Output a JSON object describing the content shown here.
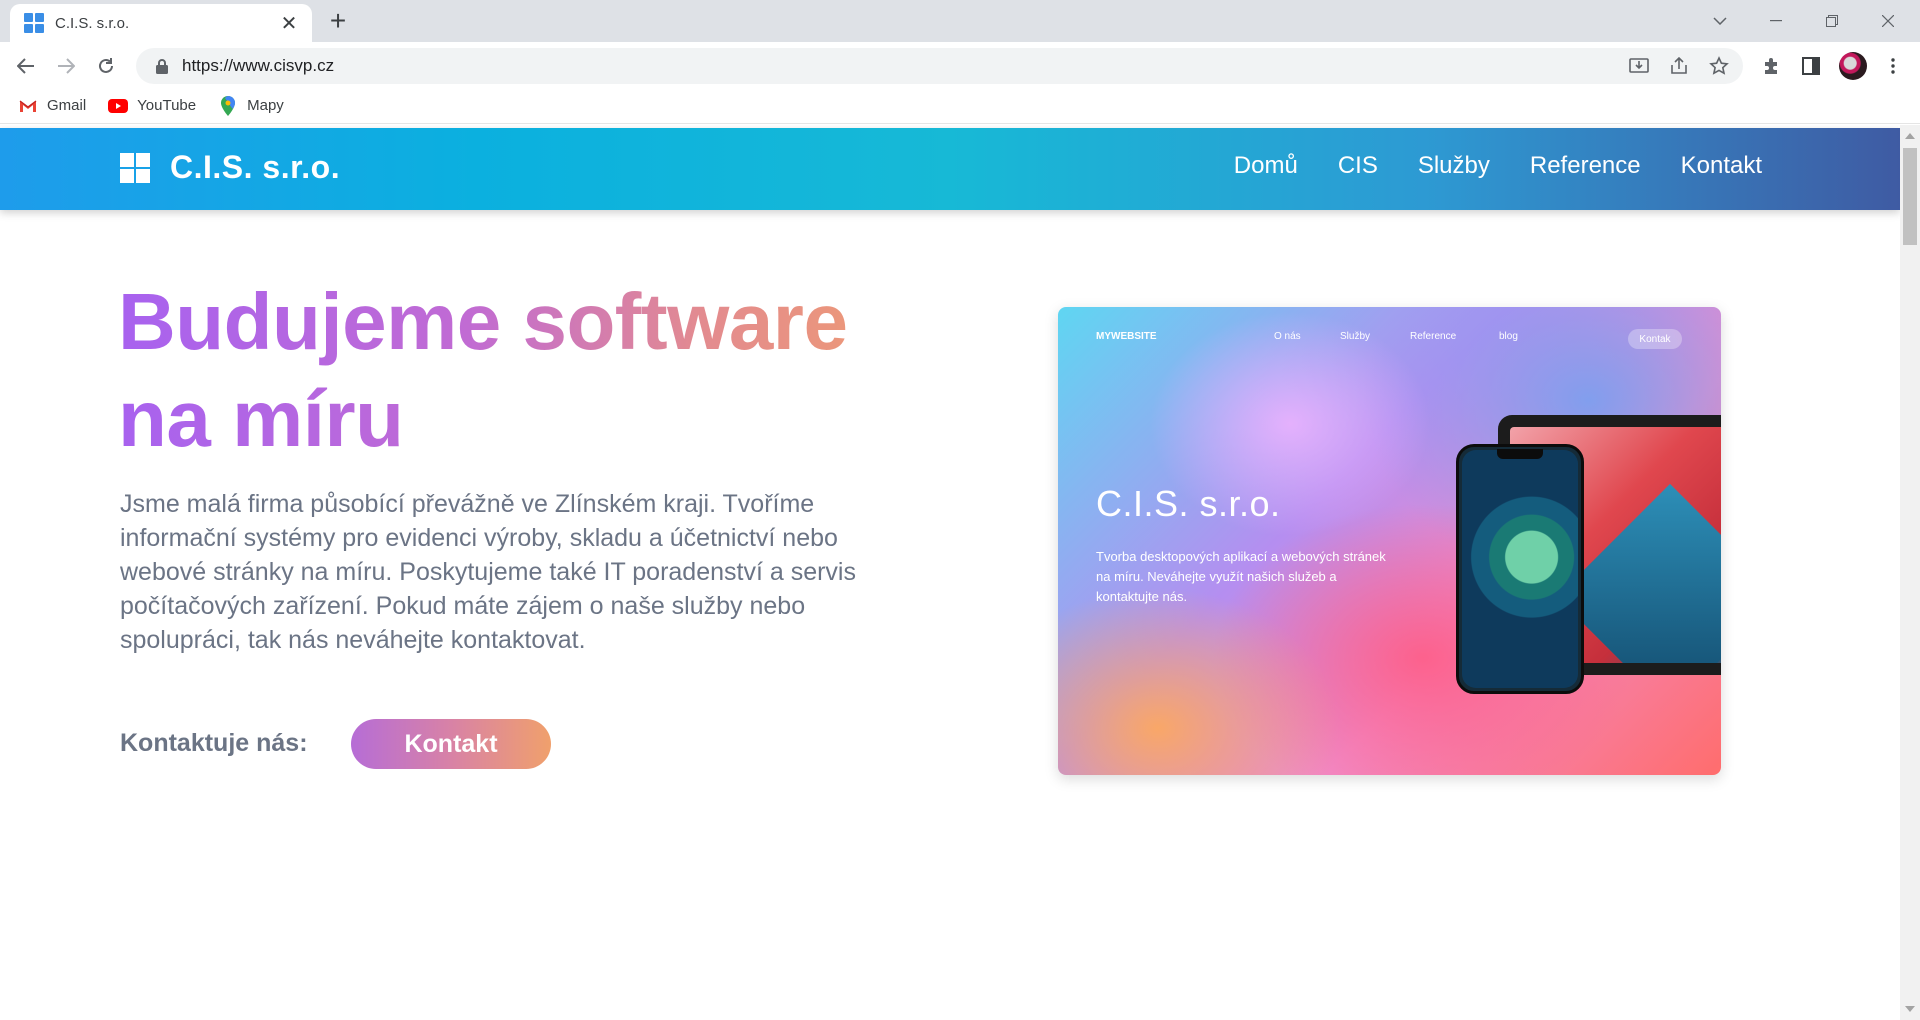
{
  "browser": {
    "tab_title": "C.I.S. s.r.o.",
    "url": "https://www.cisvp.cz",
    "bookmarks": [
      {
        "label": "Gmail",
        "icon": "gmail-icon"
      },
      {
        "label": "YouTube",
        "icon": "youtube-icon"
      },
      {
        "label": "Mapy",
        "icon": "maps-icon"
      }
    ]
  },
  "site": {
    "brand": "C.I.S. s.r.o.",
    "nav": [
      "Domů",
      "CIS",
      "Služby",
      "Reference",
      "Kontakt"
    ],
    "hero": {
      "title_line1": "Budujeme software",
      "title_line2": "na míru",
      "text": "Jsme malá firma působící převážně ve Zlínském kraji. Tvoříme informační systémy pro evidenci výroby, skladu a účetnictví nebo webové stránky na míru. Poskytujeme také IT poradenství a servis počítačových zařízení. Pokud máte zájem o naše služby nebo spolupráci, tak nás neváhejte kontaktovat.",
      "contact_label": "Kontaktuje nás:",
      "contact_button": "Kontakt"
    },
    "mockup": {
      "logo": "MYWEBSITE",
      "nav": [
        "O nás",
        "Služby",
        "Reference",
        "blog"
      ],
      "button": "Kontak",
      "title": "C.I.S. s.r.o.",
      "subtitle": "Tvorba desktopových aplikací a webových stránek na míru. Neváhejte využít našich služeb a kontaktujte nás."
    }
  },
  "colors": {
    "header_start": "#1e9ceb",
    "header_end": "#3f5ba3",
    "title_gradient_start": "#a862ef",
    "title_gradient_end": "#ee9a74",
    "body_text": "#6b7485"
  }
}
